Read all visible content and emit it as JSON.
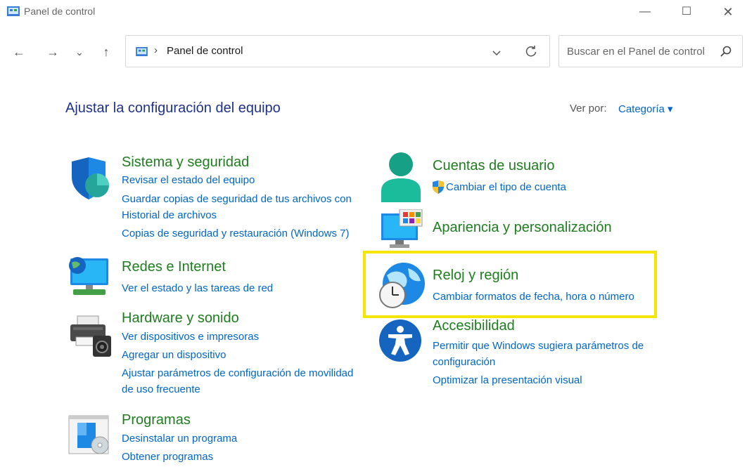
{
  "window": {
    "title": "Panel de control",
    "min": "—",
    "max": "☐",
    "close": "✕"
  },
  "nav": {
    "back": "←",
    "forward": "→",
    "recent": "⌄",
    "up": "↑"
  },
  "address": {
    "separator": "›",
    "path": "Panel de control"
  },
  "search": {
    "placeholder": "Buscar en el Panel de control"
  },
  "main": {
    "heading": "Ajustar la configuración del equipo",
    "view_by_label": "Ver por:",
    "view_by_value": "Categoría ▾"
  },
  "categories": {
    "sistema": {
      "title": "Sistema y seguridad",
      "links": [
        "Revisar el estado del equipo",
        "Guardar copias de seguridad de tus archivos con",
        "Historial de archivos",
        "Copias de seguridad y restauración (Windows 7)"
      ]
    },
    "redes": {
      "title": "Redes e Internet",
      "links": [
        "Ver el estado y las tareas de red"
      ]
    },
    "hardware": {
      "title": "Hardware y sonido",
      "links": [
        "Ver dispositivos e impresoras",
        "Agregar un dispositivo",
        "Ajustar parámetros de configuración de movilidad",
        "de uso frecuente"
      ]
    },
    "programas": {
      "title": "Programas",
      "links": [
        "Desinstalar un programa",
        "Obtener programas"
      ]
    },
    "cuentas": {
      "title": "Cuentas de usuario",
      "links": [
        "Cambiar el tipo de cuenta"
      ]
    },
    "apariencia": {
      "title": "Apariencia y personalización",
      "links": []
    },
    "reloj": {
      "title": "Reloj y región",
      "links": [
        "Cambiar formatos de fecha, hora o número"
      ]
    },
    "accesibilidad": {
      "title": "Accesibilidad",
      "links": [
        "Permitir que Windows sugiera parámetros de",
        "configuración",
        "Optimizar la presentación visual"
      ]
    }
  },
  "colors": {
    "category_title": "#1e7d1e",
    "link": "#0066cc",
    "heading": "#1e3287",
    "highlight": "#f5e600"
  }
}
